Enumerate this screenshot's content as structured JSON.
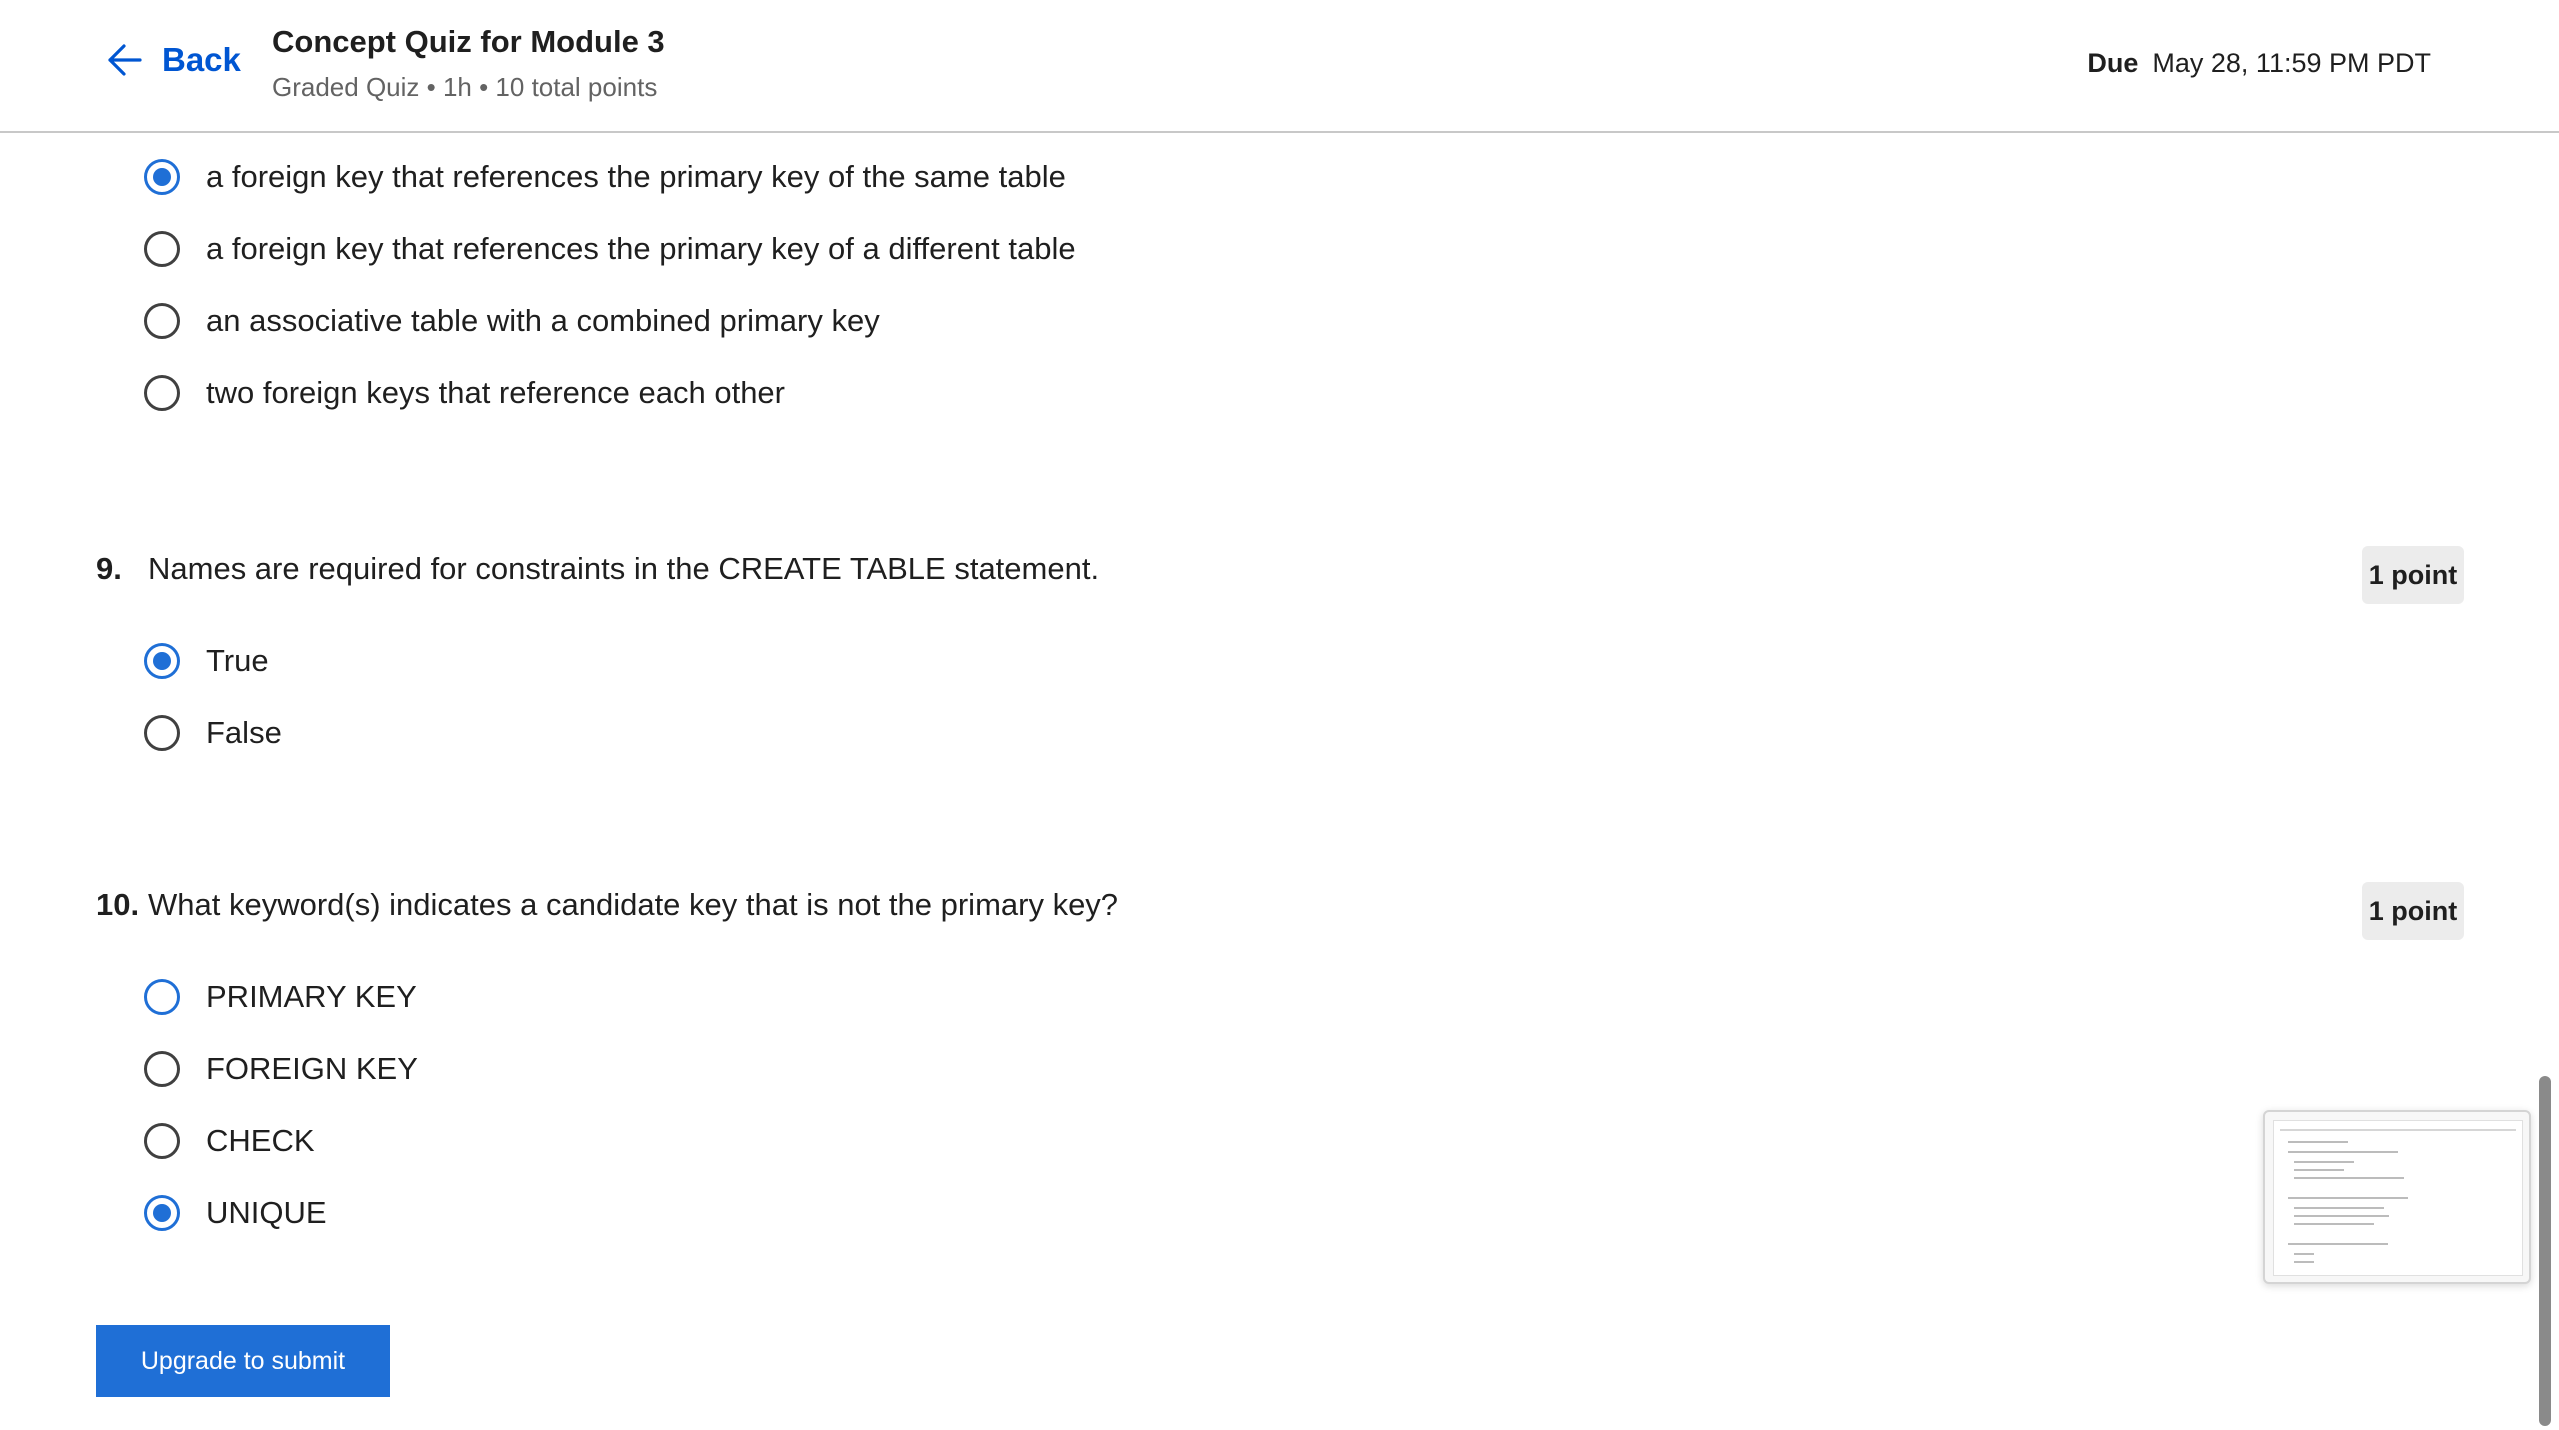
{
  "header": {
    "back_label": "Back",
    "title": "Concept Quiz for Module 3",
    "meta": "Graded Quiz • 1h • 10 total points",
    "due_label": "Due",
    "due_value": "May 28, 11:59 PM PDT"
  },
  "q8": {
    "options": [
      {
        "label": "a foreign key that references the primary key of the same table",
        "selected": true
      },
      {
        "label": "a foreign key that references the primary key of a different table",
        "selected": false
      },
      {
        "label": "an associative table with a combined primary key",
        "selected": false
      },
      {
        "label": "two foreign keys that reference each other",
        "selected": false
      }
    ]
  },
  "q9": {
    "number": "9.",
    "text": "Names are required for constraints in the CREATE TABLE statement.",
    "points": "1 point",
    "options": [
      {
        "label": "True",
        "selected": true
      },
      {
        "label": "False",
        "selected": false
      }
    ]
  },
  "q10": {
    "number": "10.",
    "text": "What keyword(s) indicates a candidate key that is not the primary key?",
    "points": "1 point",
    "options": [
      {
        "label": "PRIMARY KEY",
        "selected": false
      },
      {
        "label": "FOREIGN KEY",
        "selected": false
      },
      {
        "label": "CHECK",
        "selected": false
      },
      {
        "label": "UNIQUE",
        "selected": true
      }
    ]
  },
  "submit_label": "Upgrade to submit",
  "icons": {
    "back": "arrow-left-icon",
    "radio": "radio-button-icon"
  },
  "colors": {
    "accent": "#0056d2",
    "button": "#1f6fd6",
    "badge_bg": "#ececec"
  }
}
